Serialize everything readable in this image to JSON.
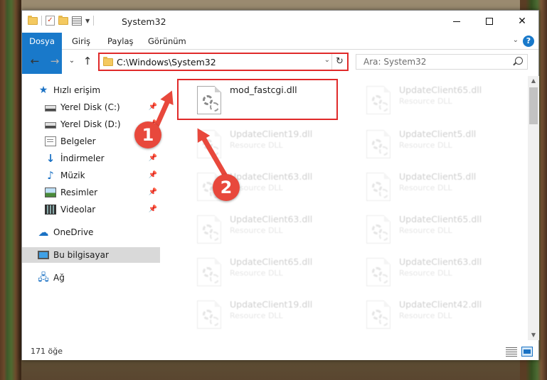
{
  "window": {
    "title": "System32",
    "controls": {
      "minimize": "",
      "maximize": "",
      "close": "✕"
    }
  },
  "ribbon": {
    "tabs": [
      "Dosya",
      "Giriş",
      "Paylaş",
      "Görünüm"
    ],
    "help": "?"
  },
  "nav": {
    "back": "←",
    "forward": "→",
    "recent": "⌄",
    "up": "↑",
    "address": "C:\\Windows\\System32",
    "refresh": "↻",
    "search_placeholder": "Ara: System32"
  },
  "sidebar": {
    "items": [
      {
        "label": "Hızlı erişim",
        "icon": "star-icon",
        "pinned": false
      },
      {
        "label": "Yerel Disk (C:)",
        "icon": "drive-icon",
        "pinned": true
      },
      {
        "label": "Yerel Disk (D:)",
        "icon": "drive-icon",
        "pinned": true
      },
      {
        "label": "Belgeler",
        "icon": "documents-icon",
        "pinned": true
      },
      {
        "label": "İndirmeler",
        "icon": "download-icon",
        "pinned": true
      },
      {
        "label": "Müzik",
        "icon": "music-icon",
        "pinned": true
      },
      {
        "label": "Resimler",
        "icon": "pictures-icon",
        "pinned": true
      },
      {
        "label": "Videolar",
        "icon": "videos-icon",
        "pinned": true
      },
      {
        "label": "OneDrive",
        "icon": "cloud-icon",
        "pinned": false
      },
      {
        "label": "Bu bilgisayar",
        "icon": "pc-icon",
        "pinned": false,
        "selected": true
      },
      {
        "label": "Ağ",
        "icon": "network-icon",
        "pinned": false
      }
    ]
  },
  "files": [
    {
      "name": "mod_fastcgi.dll",
      "type": "",
      "highlighted": true
    },
    {
      "name": "UpdateClient65.dll",
      "type": "Resource DLL"
    },
    {
      "name": "UpdateClient19.dll",
      "type": "Resource DLL"
    },
    {
      "name": "UpdateClient5.dll",
      "type": "Resource DLL"
    },
    {
      "name": "UpdateClient63.dll",
      "type": "Resource DLL"
    },
    {
      "name": "UpdateClient5.dll",
      "type": "Resource DLL"
    },
    {
      "name": "UpdateClient63.dll",
      "type": "Resource DLL"
    },
    {
      "name": "UpdateClient65.dll",
      "type": "Resource DLL"
    },
    {
      "name": "UpdateClient65.dll",
      "type": "Resource DLL"
    },
    {
      "name": "UpdateClient63.dll",
      "type": "Resource DLL"
    },
    {
      "name": "UpdateClient19.dll",
      "type": "Resource DLL"
    },
    {
      "name": "UpdateClient42.dll",
      "type": "Resource DLL"
    }
  ],
  "status": {
    "count": "171 öğe"
  },
  "annotations": {
    "step1": "1",
    "step2": "2"
  },
  "colors": {
    "accent": "#1979ca",
    "annotation": "#e8483c",
    "highlight_border": "#e02a2a"
  }
}
